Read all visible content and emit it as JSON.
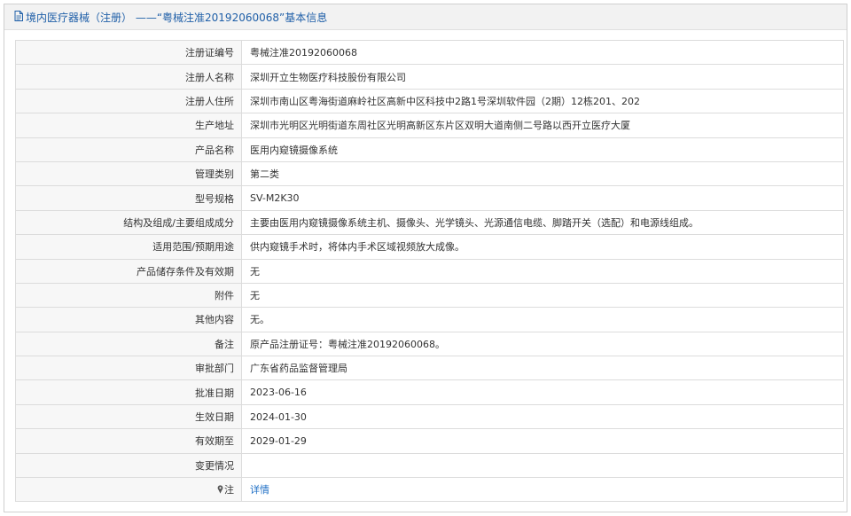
{
  "header": {
    "title": "境内医疗器械（注册） ——“粤械注准20192060068”基本信息",
    "icon": "document-icon"
  },
  "rows": [
    {
      "label": "注册证编号",
      "value": "粤械注准20192060068"
    },
    {
      "label": "注册人名称",
      "value": "深圳开立生物医疗科技股份有限公司"
    },
    {
      "label": "注册人住所",
      "value": "深圳市南山区粤海街道麻岭社区高新中区科技中2路1号深圳软件园（2期）12栋201、202"
    },
    {
      "label": "生产地址",
      "value": "深圳市光明区光明街道东周社区光明高新区东片区双明大道南侧二号路以西开立医疗大厦"
    },
    {
      "label": "产品名称",
      "value": "医用内窥镜摄像系统"
    },
    {
      "label": "管理类别",
      "value": "第二类"
    },
    {
      "label": "型号规格",
      "value": "SV-M2K30"
    },
    {
      "label": "结构及组成/主要组成成分",
      "value": "主要由医用内窥镜摄像系统主机、摄像头、光学镜头、光源通信电缆、脚踏开关（选配）和电源线组成。"
    },
    {
      "label": "适用范围/预期用途",
      "value": "供内窥镜手术时，将体内手术区域视频放大成像。"
    },
    {
      "label": "产品储存条件及有效期",
      "value": "无"
    },
    {
      "label": "附件",
      "value": "无"
    },
    {
      "label": "其他内容",
      "value": "无。"
    },
    {
      "label": "备注",
      "value": "原产品注册证号：粤械注准20192060068。"
    },
    {
      "label": "审批部门",
      "value": "广东省药品监督管理局"
    },
    {
      "label": "批准日期",
      "value": "2023-06-16"
    },
    {
      "label": "生效日期",
      "value": "2024-01-30"
    },
    {
      "label": "有效期至",
      "value": "2029-01-29"
    },
    {
      "label": "变更情况",
      "value": ""
    }
  ],
  "note_row": {
    "label": "注",
    "icon": "pin-icon",
    "link_text": "详情"
  },
  "colors": {
    "title": "#1f5fa8",
    "link": "#1f6fc5",
    "header_bg": "#f2f2f2",
    "border": "#dcdcdc"
  }
}
